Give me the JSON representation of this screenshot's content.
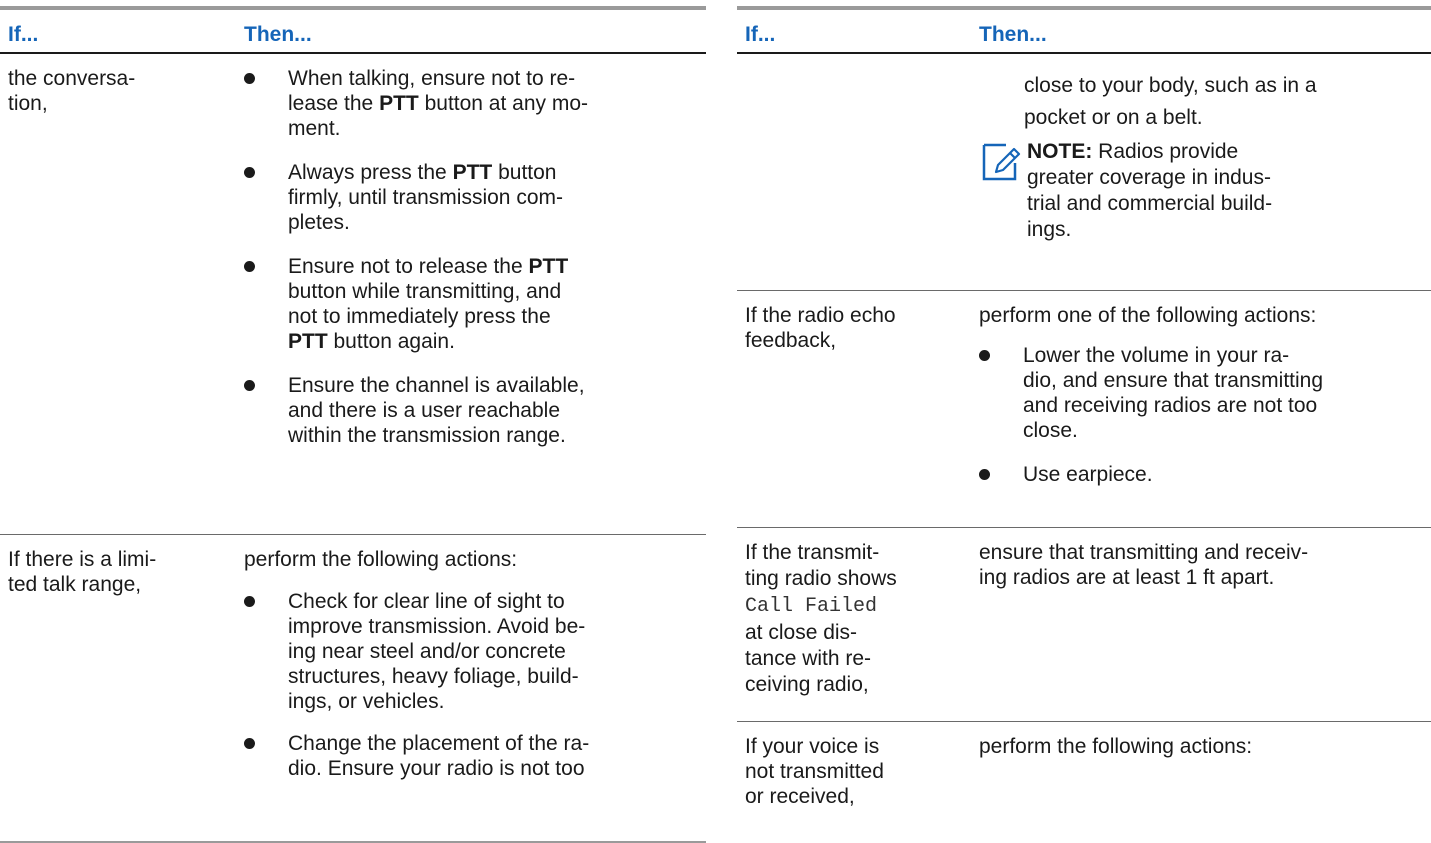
{
  "header": {
    "if_label": "If...",
    "then_label": "Then..."
  },
  "left": {
    "row1": {
      "if": [
        "the conversa-",
        "tion,"
      ],
      "items": [
        {
          "lines": [
            [
              {
                "t": "When talking, ensure not to re-"
              }
            ],
            [
              {
                "t": "lease the "
              },
              {
                "t": "PTT",
                "b": true
              },
              {
                "t": " button at any mo-"
              }
            ],
            [
              {
                "t": "ment."
              }
            ]
          ]
        },
        {
          "lines": [
            [
              {
                "t": "Always press the "
              },
              {
                "t": "PTT",
                "b": true
              },
              {
                "t": " button"
              }
            ],
            [
              {
                "t": "firmly, until transmission com-"
              }
            ],
            [
              {
                "t": "pletes."
              }
            ]
          ]
        },
        {
          "lines": [
            [
              {
                "t": "Ensure not to release the "
              },
              {
                "t": "PTT",
                "b": true
              }
            ],
            [
              {
                "t": "button while transmitting, and"
              }
            ],
            [
              {
                "t": "not to immediately press the"
              }
            ],
            [
              {
                "t": "PTT",
                "b": true
              },
              {
                "t": " button again."
              }
            ]
          ]
        },
        {
          "lines": [
            [
              {
                "t": "Ensure the channel is available,"
              }
            ],
            [
              {
                "t": "and there is a user reachable"
              }
            ],
            [
              {
                "t": "within the transmission range."
              }
            ]
          ]
        }
      ]
    },
    "row2": {
      "if": [
        "If there is a limi-",
        "ted talk range,"
      ],
      "intro": "perform the following actions:",
      "items": [
        {
          "lines": [
            [
              {
                "t": "Check for clear line of sight to"
              }
            ],
            [
              {
                "t": "improve transmission. Avoid be-"
              }
            ],
            [
              {
                "t": "ing near steel and/or concrete"
              }
            ],
            [
              {
                "t": "structures, heavy foliage, build-"
              }
            ],
            [
              {
                "t": "ings, or vehicles."
              }
            ]
          ]
        },
        {
          "lines": [
            [
              {
                "t": "Change the placement of the ra-"
              }
            ],
            [
              {
                "t": "dio. Ensure your radio is not too"
              }
            ]
          ]
        }
      ]
    }
  },
  "right": {
    "cont": {
      "lines": [
        "close to your body, such as in a",
        "pocket or on a belt."
      ],
      "note_lines": [
        [
          {
            "t": "NOTE:",
            "b": true
          },
          {
            "t": " Radios provide"
          }
        ],
        [
          {
            "t": "greater coverage in indus-"
          }
        ],
        [
          {
            "t": "trial and commercial build-"
          }
        ],
        [
          {
            "t": "ings."
          }
        ]
      ]
    },
    "echo": {
      "if": [
        "If the radio echo",
        "feedback,"
      ],
      "intro": "perform one of the following actions:",
      "items": [
        {
          "lines": [
            [
              {
                "t": "Lower the volume in your ra-"
              }
            ],
            [
              {
                "t": "dio, and ensure that transmitting"
              }
            ],
            [
              {
                "t": "and receiving radios are not too"
              }
            ],
            [
              {
                "t": "close."
              }
            ]
          ]
        },
        {
          "lines": [
            [
              {
                "t": "Use earpiece."
              }
            ]
          ]
        }
      ]
    },
    "callfailed": {
      "if_lines": [
        [
          {
            "t": "If the transmit-"
          }
        ],
        [
          {
            "t": "ting radio shows"
          }
        ],
        [
          {
            "t": "Call Failed",
            "m": true
          }
        ],
        [
          {
            "t": "at close dis-"
          }
        ],
        [
          {
            "t": "tance with re-"
          }
        ],
        [
          {
            "t": "ceiving radio,"
          }
        ]
      ],
      "then": [
        "ensure that transmitting and receiv-",
        "ing radios are at least 1 ft apart."
      ]
    },
    "voice": {
      "if": [
        "If your voice is",
        "not transmitted",
        "or received,"
      ],
      "then": "perform the following actions:"
    }
  }
}
